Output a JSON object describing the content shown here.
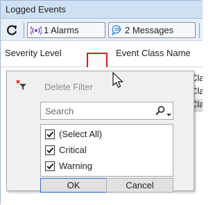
{
  "window": {
    "title": "Logged Events"
  },
  "toolbar": {
    "alarms_label": "1 Alarms",
    "messages_label": "2 Messages"
  },
  "grid": {
    "columns": [
      "Severity Level",
      "Event Class Name"
    ],
    "rows": [
      {
        "event_class": "Cla"
      },
      {
        "event_class": "Cla"
      },
      {
        "event_class": "Cla"
      }
    ]
  },
  "filter_popup": {
    "delete_filter_label": "Delete Filter",
    "search_placeholder": "Search",
    "items": [
      {
        "label": "(Select All)",
        "checked": true
      },
      {
        "label": "Critical",
        "checked": true
      },
      {
        "label": "Warning",
        "checked": true
      }
    ],
    "ok_label": "OK",
    "cancel_label": "Cancel"
  },
  "colors": {
    "panel_bg": "#dbe8f6",
    "highlight_border": "#e0161b",
    "ok_border": "#2c6ecb",
    "alarm_icon": "#6a3fb0",
    "message_icon": "#2b7fd0"
  },
  "icons": [
    "refresh-icon",
    "alarm-icon",
    "message-icon",
    "funnel-delete-icon",
    "mouse-cursor-icon",
    "search-icon",
    "chevron-down-icon",
    "checkmark-icon"
  ]
}
